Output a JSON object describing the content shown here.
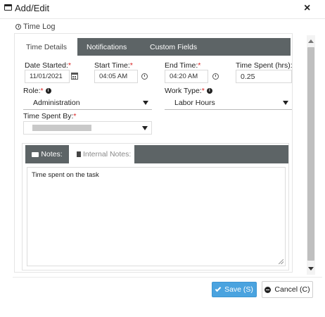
{
  "window": {
    "title": "Add/Edit",
    "close_glyph": "×"
  },
  "section": {
    "label": "Time Log"
  },
  "tabs": [
    {
      "label": "Time Details",
      "active": true
    },
    {
      "label": "Notifications",
      "active": false
    },
    {
      "label": "Custom Fields",
      "active": false
    }
  ],
  "form": {
    "date_started": {
      "label": "Date Started:",
      "value": "11/01/2021"
    },
    "start_time": {
      "label": "Start Time:",
      "value": "04:05 AM"
    },
    "end_time": {
      "label": "End Time:",
      "value": "04:20 AM"
    },
    "time_spent": {
      "label": "Time Spent (hrs):",
      "value": "0.25"
    },
    "role": {
      "label": "Role:",
      "value": "Administration"
    },
    "work_type": {
      "label": "Work Type:",
      "value": "Labor Hours"
    },
    "time_spent_by": {
      "label": "Time Spent By:",
      "value": ""
    },
    "required_mark": "*"
  },
  "notes_tabs": [
    {
      "label": "Notes:",
      "active": false
    },
    {
      "label": "Internal Notes:",
      "active": true
    }
  ],
  "notes": {
    "text": "Time spent on the task"
  },
  "buttons": {
    "save": "Save (S)",
    "cancel": "Cancel (C)"
  },
  "icons": {
    "window": "window-icon",
    "section": "clock-icon",
    "calendar": "calendar-icon",
    "time": "clock-icon",
    "info": "info-icon",
    "dropdown": "caret-down-icon",
    "save": "check-icon",
    "cancel": "minus-circle-icon"
  },
  "colors": {
    "tab_bar": "#5d6466",
    "required": "#d81f1f",
    "save_button": "#4aa3df"
  }
}
